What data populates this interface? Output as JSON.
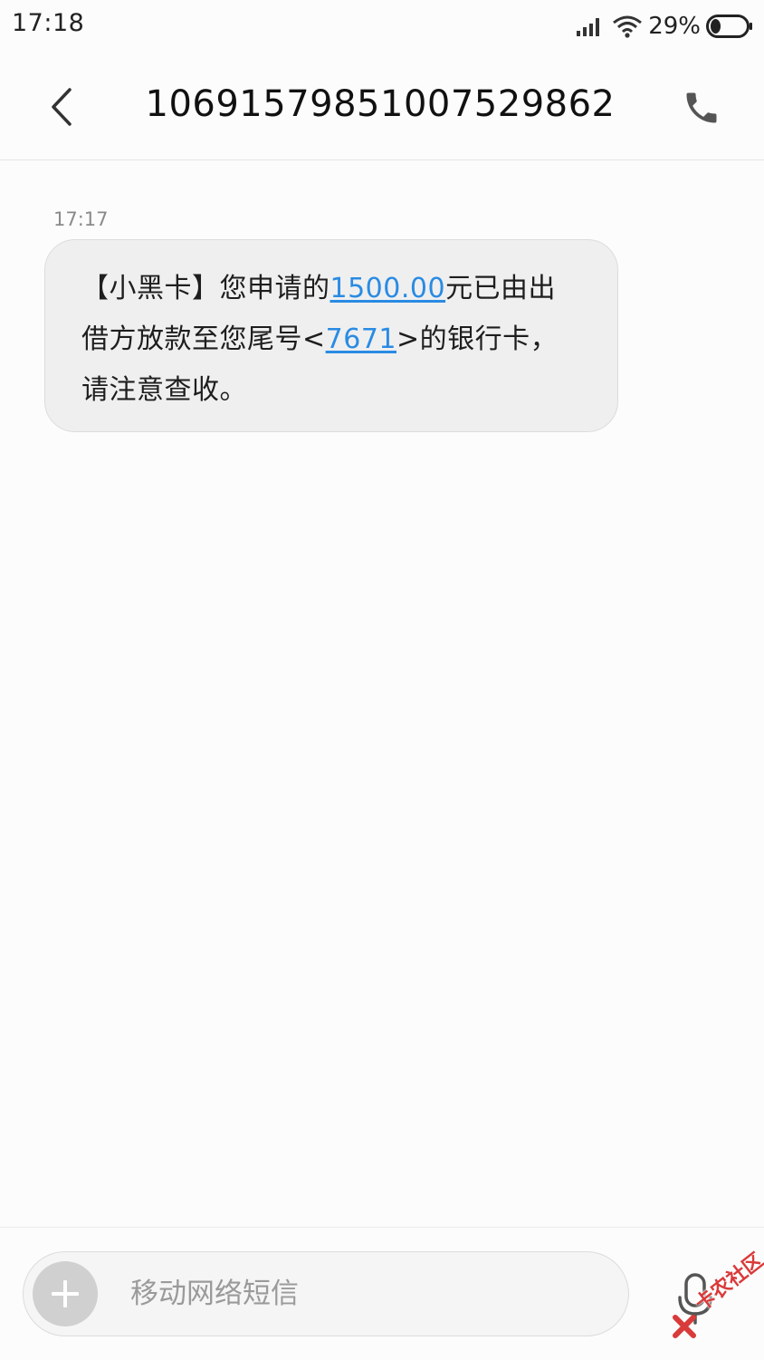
{
  "status_bar": {
    "time": "17:18",
    "battery_percent": "29%",
    "battery_level": 0.29,
    "icons": [
      "signal-icon",
      "wifi-icon",
      "battery-icon"
    ]
  },
  "header": {
    "back_icon": "chevron-left-icon",
    "title": "1069157985100752986 2",
    "call_icon": "phone-icon"
  },
  "conversation": {
    "messages": [
      {
        "time": "17:17",
        "text_parts": {
          "part1": "【小黑卡】您申请的",
          "amount_link": "1500.00",
          "part2": "元已由出借方放款至您尾号<",
          "card_link": "7671",
          "part3": ">的银行卡，请注意查收。"
        }
      }
    ]
  },
  "composer": {
    "add_icon": "plus-icon",
    "placeholder": "移动网络短信",
    "value": "",
    "mic_icon": "microphone-icon"
  },
  "watermark": {
    "text": "卡农社区"
  },
  "colors": {
    "link": "#2a8be3",
    "bubble_bg": "#efefef",
    "background": "#fcfcfc",
    "watermark": "#d93a3a"
  }
}
